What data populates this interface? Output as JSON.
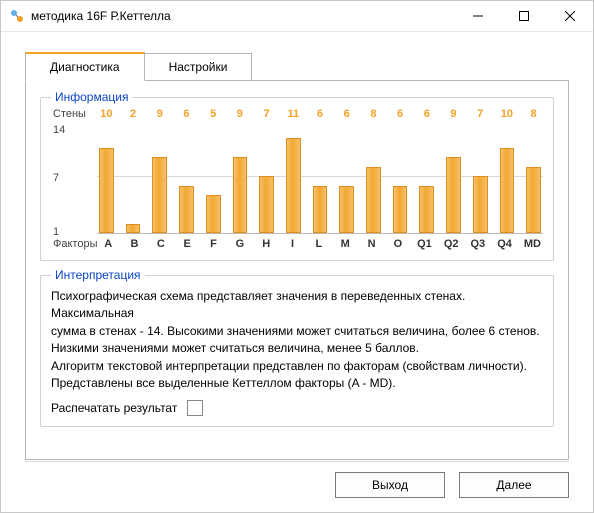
{
  "window": {
    "title": "методика 16F Р.Кеттелла"
  },
  "tabs": {
    "diagnostics": "Диагностика",
    "settings": "Настройки"
  },
  "group_info_legend": "Информация",
  "group_interp_legend": "Интерпретация",
  "axis": {
    "y_title": "Стены",
    "x_title": "Факторы",
    "y14": "14",
    "y7": "7",
    "y1": "1"
  },
  "interp": {
    "p1": "Психографическая схема представляет значения в переведенных стенах. Максимальная",
    "p2": "сумма в стенах  - 14. Высокими значениями может считаться величина, более 6 стенов.",
    "p3": "Низкими значениями может считаться величина, менее 5 баллов.",
    "p4": "Алгоритм текстовой интерпретации представлен по факторам  (свойствам личности).",
    "p5": "Представлены все выделенные Кеттеллом факторы (A - MD).",
    "print": "Распечатать результат"
  },
  "buttons": {
    "exit": "Выход",
    "next": "Далее"
  },
  "chart_data": {
    "type": "bar",
    "title": "",
    "xlabel": "Факторы",
    "ylabel": "Стены",
    "ylim": [
      1,
      14
    ],
    "categories": [
      "A",
      "B",
      "C",
      "E",
      "F",
      "G",
      "H",
      "I",
      "L",
      "M",
      "N",
      "O",
      "Q1",
      "Q2",
      "Q3",
      "Q4",
      "MD"
    ],
    "values": [
      10,
      2,
      9,
      6,
      5,
      9,
      7,
      11,
      6,
      6,
      8,
      6,
      6,
      9,
      7,
      10,
      8
    ]
  }
}
